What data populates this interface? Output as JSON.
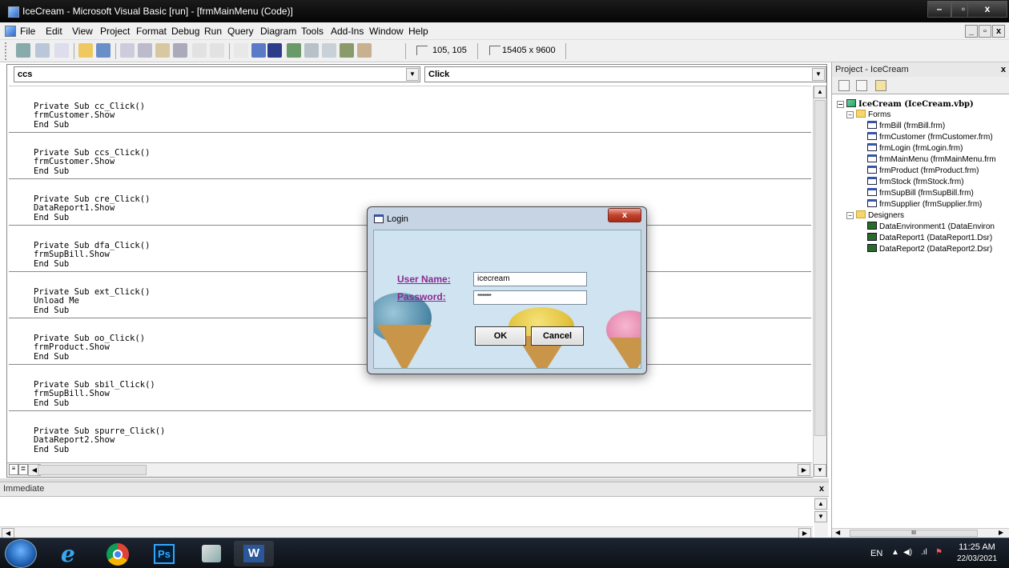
{
  "window": {
    "title": "IceCream - Microsoft Visual Basic [run] - [frmMainMenu (Code)]",
    "min": "–",
    "max": "▫",
    "close": "x"
  },
  "menu": {
    "items": [
      "File",
      "Edit",
      "View",
      "Project",
      "Format",
      "Debug",
      "Run",
      "Query",
      "Diagram",
      "Tools",
      "Add-Ins",
      "Window",
      "Help"
    ],
    "mdi_min": "_",
    "mdi_restore": "▫",
    "mdi_close": "x"
  },
  "toolbar": {
    "position": "105, 105",
    "size": "15405 x 9600"
  },
  "code_window": {
    "object_combo": "ccs",
    "proc_combo": "Click",
    "procedures": [
      {
        "lines": [
          "Private Sub cc_Click()",
          "frmCustomer.Show",
          "End Sub"
        ]
      },
      {
        "lines": [
          "Private Sub ccs_Click()",
          "frmCustomer.Show",
          "End Sub"
        ]
      },
      {
        "lines": [
          "Private Sub cre_Click()",
          "DataReport1.Show",
          "End Sub"
        ]
      },
      {
        "lines": [
          "Private Sub dfa_Click()",
          "frmSupBill.Show",
          "End Sub"
        ]
      },
      {
        "lines": [
          "Private Sub ext_Click()",
          "Unload Me",
          "End Sub"
        ]
      },
      {
        "lines": [
          "Private Sub oo_Click()",
          "frmProduct.Show",
          "End Sub"
        ]
      },
      {
        "lines": [
          "Private Sub sbil_Click()",
          "frmSupBill.Show",
          "End Sub"
        ]
      },
      {
        "lines": [
          "Private Sub spurre_Click()",
          "DataReport2.Show",
          "End Sub"
        ]
      }
    ]
  },
  "immediate": {
    "title": "Immediate",
    "close": "x"
  },
  "project": {
    "title": "Project - IceCream",
    "close": "x",
    "root": "IceCream (IceCream.vbp)",
    "forms_folder": "Forms",
    "forms": [
      "frmBill (frmBill.frm)",
      "frmCustomer (frmCustomer.frm)",
      "frmLogin (frmLogin.frm)",
      "frmMainMenu (frmMainMenu.frm",
      "frmProduct (frmProduct.frm)",
      "frmStock (frmStock.frm)",
      "frmSupBill (frmSupBill.frm)",
      "frmSupplier (frmSupplier.frm)"
    ],
    "designers_folder": "Designers",
    "designers": [
      "DataEnvironment1 (DataEnviron",
      "DataReport1 (DataReport1.Dsr)",
      "DataReport2 (DataReport2.Dsr)"
    ],
    "hscroll_grip": "III"
  },
  "login": {
    "title": "Login",
    "close": "x",
    "user_label": "User Name:",
    "user_value": "icecream",
    "password_label": "Password:",
    "password_value": "********",
    "ok_label": "OK",
    "cancel_label": "Cancel"
  },
  "taskbar": {
    "apps": [
      "internet-explorer",
      "chrome",
      "photoshop",
      "paint",
      "word"
    ],
    "ps_label": "Ps",
    "word_label": "W",
    "lang": "EN",
    "time": "11:25 AM",
    "date": "22/03/2021"
  }
}
